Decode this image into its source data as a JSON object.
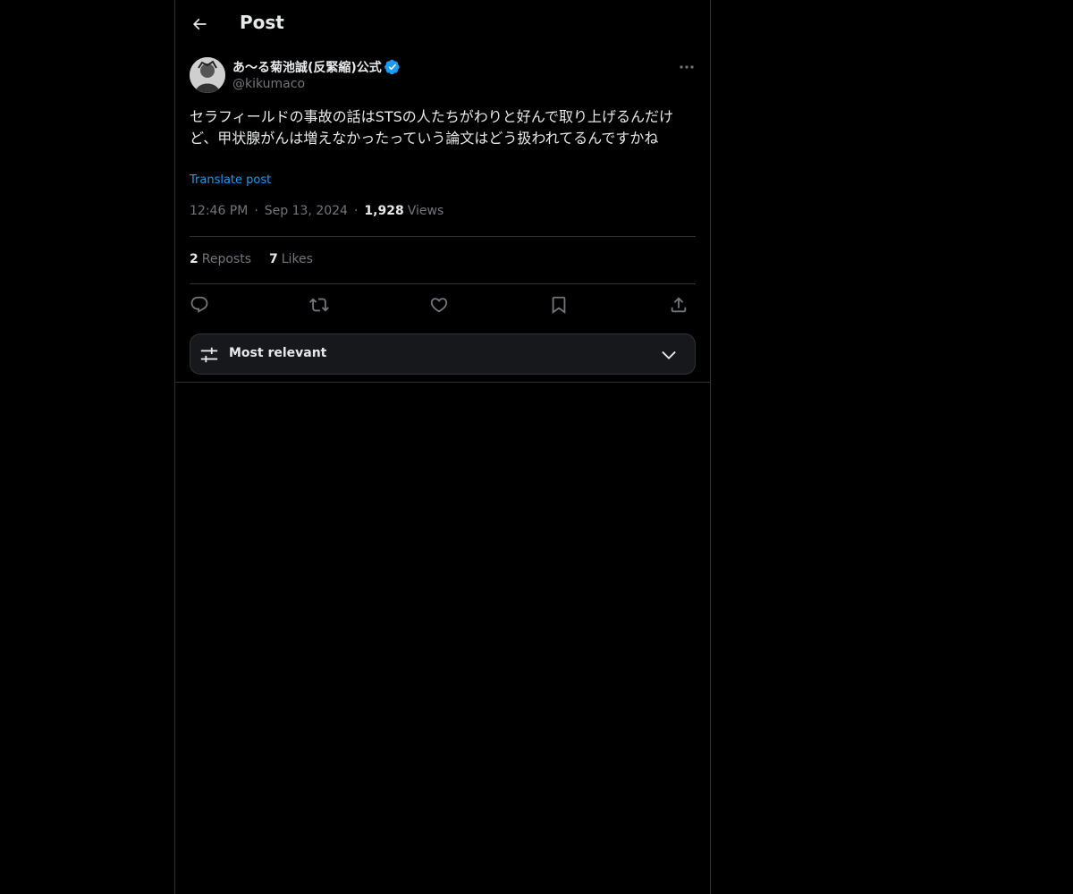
{
  "header": {
    "title": "Post",
    "back_icon": "arrow-left-icon"
  },
  "post": {
    "author": {
      "display_name": "あ〜る菊池誠(反緊縮)公式",
      "handle": "@kikumaco",
      "verified": true
    },
    "text": "セラフィールドの事故の話はSTSの人たちがわりと好んで取り上げるんだけど、甲状腺がんは増えなかったっていう論文はどう扱われてるんですかね",
    "translate_label": "Translate post",
    "time": "12:46 PM",
    "date": "Sep 13, 2024",
    "separator": "·",
    "views_count": "1,928",
    "views_label": "Views",
    "stats": {
      "reposts_count": "2",
      "reposts_label": "Reposts",
      "likes_count": "7",
      "likes_label": "Likes"
    }
  },
  "sort": {
    "label": "Most relevant"
  },
  "colors": {
    "background": "#000000",
    "text": "#e7e9ea",
    "muted": "#71767b",
    "accent": "#1d9bf0",
    "border": "#2f3336"
  }
}
